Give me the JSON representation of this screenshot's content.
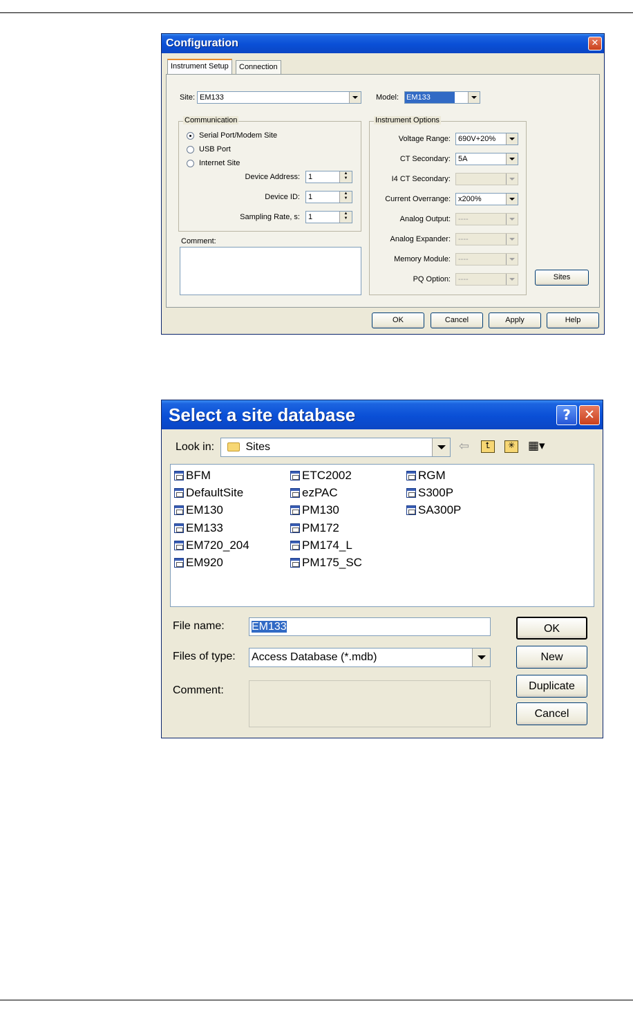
{
  "config_dialog": {
    "title": "Configuration",
    "tabs": [
      "Instrument Setup",
      "Connection"
    ],
    "site_label": "Site:",
    "site_value": "EM133",
    "model_label": "Model:",
    "model_value": "EM133",
    "communication": {
      "title": "Communication",
      "options": [
        "Serial Port/Modem Site",
        "USB Port",
        "Internet Site"
      ],
      "selected_index": 0,
      "device_address_label": "Device Address:",
      "device_address_value": "1",
      "device_id_label": "Device ID:",
      "device_id_value": "1",
      "sampling_rate_label": "Sampling Rate, s:",
      "sampling_rate_value": "1"
    },
    "comment_label": "Comment:",
    "instrument_options": {
      "title": "Instrument Options",
      "rows": [
        {
          "label": "Voltage Range:",
          "value": "690V+20%",
          "enabled": true
        },
        {
          "label": "CT Secondary:",
          "value": "5A",
          "enabled": true
        },
        {
          "label": "I4 CT Secondary:",
          "value": "",
          "enabled": false
        },
        {
          "label": "Current Overrange:",
          "value": "x200%",
          "enabled": true
        },
        {
          "label": "Analog Output:",
          "value": "----",
          "enabled": false
        },
        {
          "label": "Analog Expander:",
          "value": "----",
          "enabled": false
        },
        {
          "label": "Memory Module:",
          "value": "----",
          "enabled": false
        },
        {
          "label": "PQ Option:",
          "value": "----",
          "enabled": false
        }
      ]
    },
    "sites_button": "Sites",
    "buttons": {
      "ok": "OK",
      "cancel": "Cancel",
      "apply": "Apply",
      "help": "Help"
    }
  },
  "site_dialog": {
    "title": "Select a site database",
    "help_button": "?",
    "close_button": "X",
    "look_in_label": "Look in:",
    "look_in_value": "Sites",
    "files_col1": [
      "BFM",
      "DefaultSite",
      "EM130",
      "EM133",
      "EM720_204",
      "EM920"
    ],
    "files_col2": [
      "ETC2002",
      "ezPAC",
      "PM130",
      "PM172",
      "PM174_L",
      "PM175_SC"
    ],
    "files_col3": [
      "RGM",
      "S300P",
      "SA300P"
    ],
    "file_name_label": "File name:",
    "file_name_value": "EM133",
    "files_of_type_label": "Files of type:",
    "files_of_type_value": "Access Database (*.mdb)",
    "comment_label": "Comment:",
    "buttons": {
      "ok": "OK",
      "new": "New",
      "duplicate": "Duplicate",
      "cancel": "Cancel"
    }
  }
}
